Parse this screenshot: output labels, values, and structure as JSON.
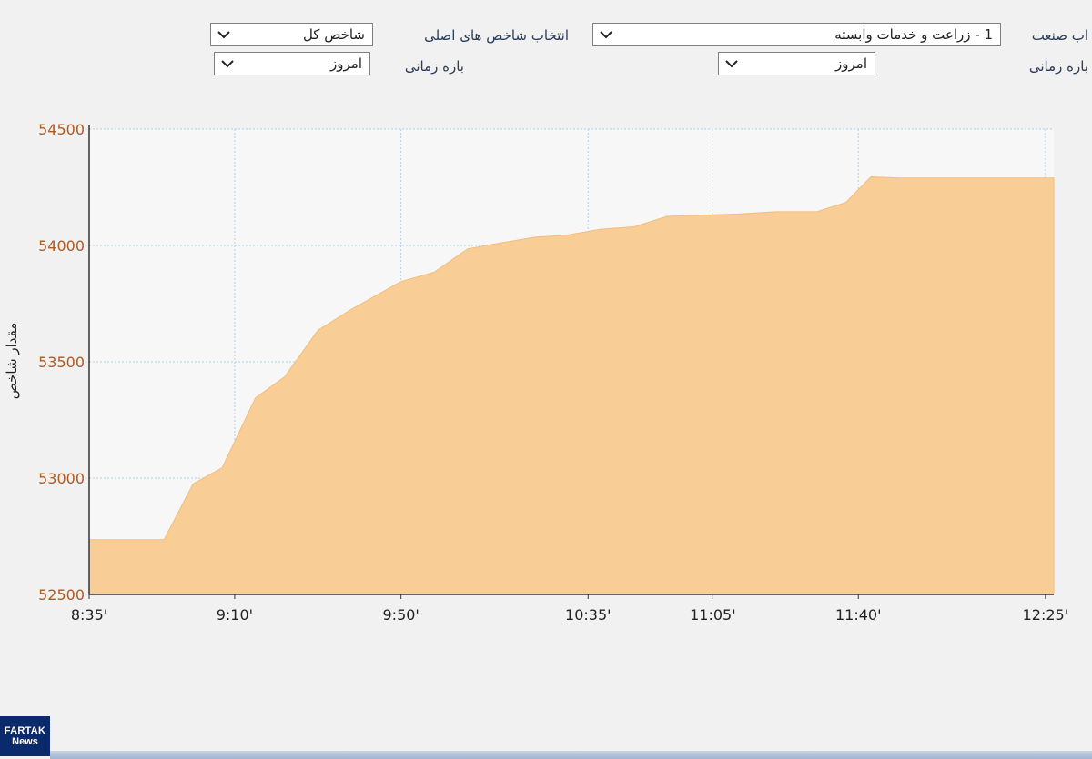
{
  "controls": {
    "industry_label": "اب صنعت",
    "industry_value": "1 - زراعت و خدمات وابسته",
    "industry_period_label": "بازه زمانی",
    "industry_period_value": "امروز",
    "index_label": "انتخاب شاخص های اصلی",
    "index_value": "شاخص کل",
    "index_period_label": "بازه زمانی",
    "index_period_value": "امروز"
  },
  "chart_data": {
    "type": "area",
    "ylabel": "مقدار شاخص",
    "xlabel": "",
    "ylim": [
      52500,
      54500
    ],
    "yticks": [
      52500,
      53000,
      53500,
      54000,
      54500
    ],
    "x_ticks": [
      "8:35'",
      "9:10'",
      "9:50'",
      "10:35'",
      "11:05'",
      "11:40'",
      "12:25'"
    ],
    "x_tick_minutes": [
      515,
      550,
      590,
      635,
      665,
      700,
      745
    ],
    "grid": true,
    "fill_color": "#f9cd96",
    "series": [
      {
        "points": [
          [
            515,
            52735
          ],
          [
            533,
            52735
          ],
          [
            540,
            52975
          ],
          [
            547,
            53045
          ],
          [
            555,
            53345
          ],
          [
            562,
            53435
          ],
          [
            570,
            53635
          ],
          [
            578,
            53725
          ],
          [
            590,
            53845
          ],
          [
            598,
            53885
          ],
          [
            606,
            53985
          ],
          [
            612,
            54005
          ],
          [
            622,
            54035
          ],
          [
            630,
            54045
          ],
          [
            638,
            54070
          ],
          [
            646,
            54080
          ],
          [
            654,
            54125
          ],
          [
            662,
            54130
          ],
          [
            671,
            54135
          ],
          [
            680,
            54145
          ],
          [
            690,
            54145
          ],
          [
            697,
            54185
          ],
          [
            703,
            54295
          ],
          [
            710,
            54290
          ],
          [
            730,
            54290
          ],
          [
            747,
            54290
          ]
        ]
      }
    ]
  },
  "branding": {
    "line1": "FARTAK",
    "line2": "News"
  }
}
